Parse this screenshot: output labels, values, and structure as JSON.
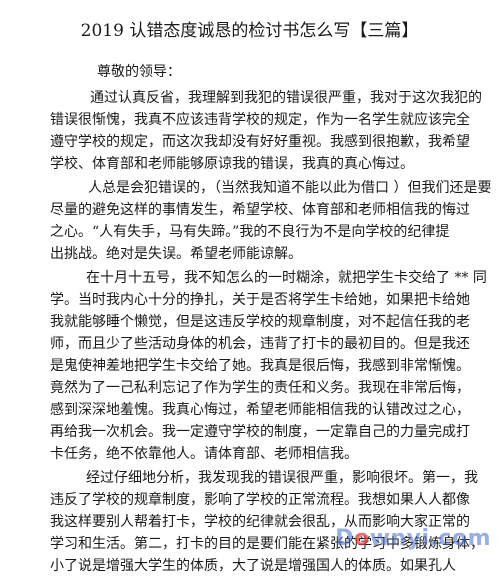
{
  "title": "2019  认错态度诚恳的检讨书怎么写【三篇】",
  "salutation": "尊敬的领导：",
  "para1": [
    "通过认真反省，我理解到我犯的错误很严重，我对于这次我犯的",
    "错误很惭愧，我真不应该违背学校的规定，作为一名学生就应该完全",
    "遵守学校的规定，而这次我却没有好好重视。我感到很抱歉，我希望",
    "学校、体育部和老师能够原谅我的错误，我真的真心悔过。"
  ],
  "para2": [
    "人总是会犯错误的，（当然我知道不能以此为借口  ）但我们还是要",
    "尽量的避免这样的事情发生，希望学校、体育部和老师相信我的悔过",
    "之心。“人有失手，马有失蹄。”我的不良行为不是向学校的纪律提",
    "出挑战。绝对是失误。希望老师能谅解。"
  ],
  "para3": [
    "在十月十五号，我不知怎么的一时糊涂，就把学生卡交给了       ** 同",
    "学。当时我内心十分的挣扎，关于是否将学生卡给她，如果把卡给她",
    "我就能够睡个懒觉，但是这违反学校的规章制度，对不起信任我的老",
    "师，而且少了些活动身体的机会，违背了打卡的最初目的。但是我还",
    "是鬼使神差地把学生卡交给了她。我真是很后悔，我感到非常惭愧。",
    "竟然为了一己私利忘记了作为学生的责任和义务。我现在非常后悔，",
    "感到深深地羞愧。我真心悔过，希望老师能相信我的认错改过之心，",
    "再给我一次机会。我一定遵守学校的制度，一定靠自己的力量完成打",
    "卡任务，绝不依靠他人。请体育部、老师相信我。"
  ],
  "para4": [
    "经过仔细地分析，我发现我的错误很严重，影响很坏。第一，我",
    "违反了学校的规章制度，影响了学校的正常流程。我想如果人人都像",
    "我这样要别人帮着打卡，学校的纪律就会很乱，从而影响大家正常的",
    "学习和生活。第二，打卡的目的是要们能在紧张的学习中多锻炼身体，",
    "小了说是增强大学生的体质，大了说是增强国人的体质。如果孔人"
  ],
  "watermark": {
    "prefix": "D",
    "mid": "o",
    "suffix": "wnyi.com"
  }
}
